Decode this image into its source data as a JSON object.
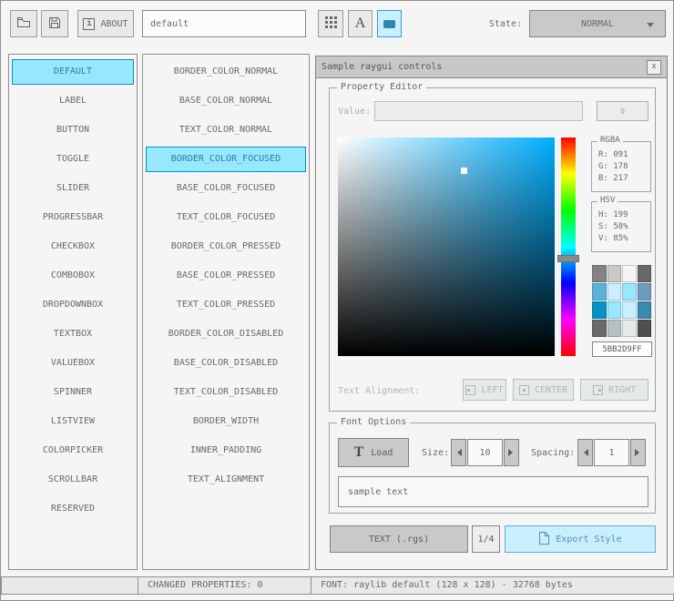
{
  "toolbar": {
    "about_label": "ABOUT",
    "about_icon_glyph": "i",
    "style_name": "default",
    "state_label": "State:",
    "state_value": "NORMAL"
  },
  "controls_list": {
    "selected_index": 0,
    "items": [
      "DEFAULT",
      "LABEL",
      "BUTTON",
      "TOGGLE",
      "SLIDER",
      "PROGRESSBAR",
      "CHECKBOX",
      "COMBOBOX",
      "DROPDOWNBOX",
      "TEXTBOX",
      "VALUEBOX",
      "SPINNER",
      "LISTVIEW",
      "COLORPICKER",
      "SCROLLBAR",
      "RESERVED"
    ]
  },
  "properties_list": {
    "selected_index": 3,
    "items": [
      "BORDER_COLOR_NORMAL",
      "BASE_COLOR_NORMAL",
      "TEXT_COLOR_NORMAL",
      "BORDER_COLOR_FOCUSED",
      "BASE_COLOR_FOCUSED",
      "TEXT_COLOR_FOCUSED",
      "BORDER_COLOR_PRESSED",
      "BASE_COLOR_PRESSED",
      "TEXT_COLOR_PRESSED",
      "BORDER_COLOR_DISABLED",
      "BASE_COLOR_DISABLED",
      "TEXT_COLOR_DISABLED",
      "BORDER_WIDTH",
      "INNER_PADDING",
      "TEXT_ALIGNMENT"
    ]
  },
  "sample_window": {
    "title": "Sample raygui controls",
    "close_label": "x",
    "property_editor": {
      "title": "Property Editor",
      "value_label": "Value:",
      "value_text": "",
      "value_button_label": "0",
      "rgba_title": "RGBA",
      "rgba_r": "R: 091",
      "rgba_g": "G: 178",
      "rgba_b": "B: 217",
      "hsv_title": "HSV",
      "hsv_h": "H: 199",
      "hsv_s": "S: 58%",
      "hsv_v": "V: 85%",
      "hex_value": "5BB2D9FF",
      "selected_color": "#5BB2D9",
      "palette_colors": [
        "#838383",
        "#C9C9C9",
        "#F5F5F5",
        "#686868",
        "#5BB2D9",
        "#C9EFFF",
        "#97E8FF",
        "#6C9BBC",
        "#0492C7",
        "#97E8FF",
        "#C9EFFF",
        "#368BAF",
        "#6A6A6A",
        "#B5C1C2",
        "#E6E9E9",
        "#4F4F4F"
      ],
      "text_alignment_label": "Text Alignment:",
      "align_left": "LEFT",
      "align_center": "CENTER",
      "align_right": "RIGHT"
    },
    "font_options": {
      "title": "Font Options",
      "load_label": "Load",
      "load_icon_glyph": "T",
      "size_label": "Size:",
      "size_value": "10",
      "spacing_label": "Spacing:",
      "spacing_value": "1",
      "sample_text": "sample text"
    },
    "export": {
      "format_label": "TEXT (.rgs)",
      "pager_label": "1/4",
      "export_label": "Export Style"
    }
  },
  "statusbar": {
    "left": "",
    "changed_properties": "CHANGED PROPERTIES: 0",
    "font_info": "FONT: raylib default (128 x 128) - 32768 bytes"
  }
}
